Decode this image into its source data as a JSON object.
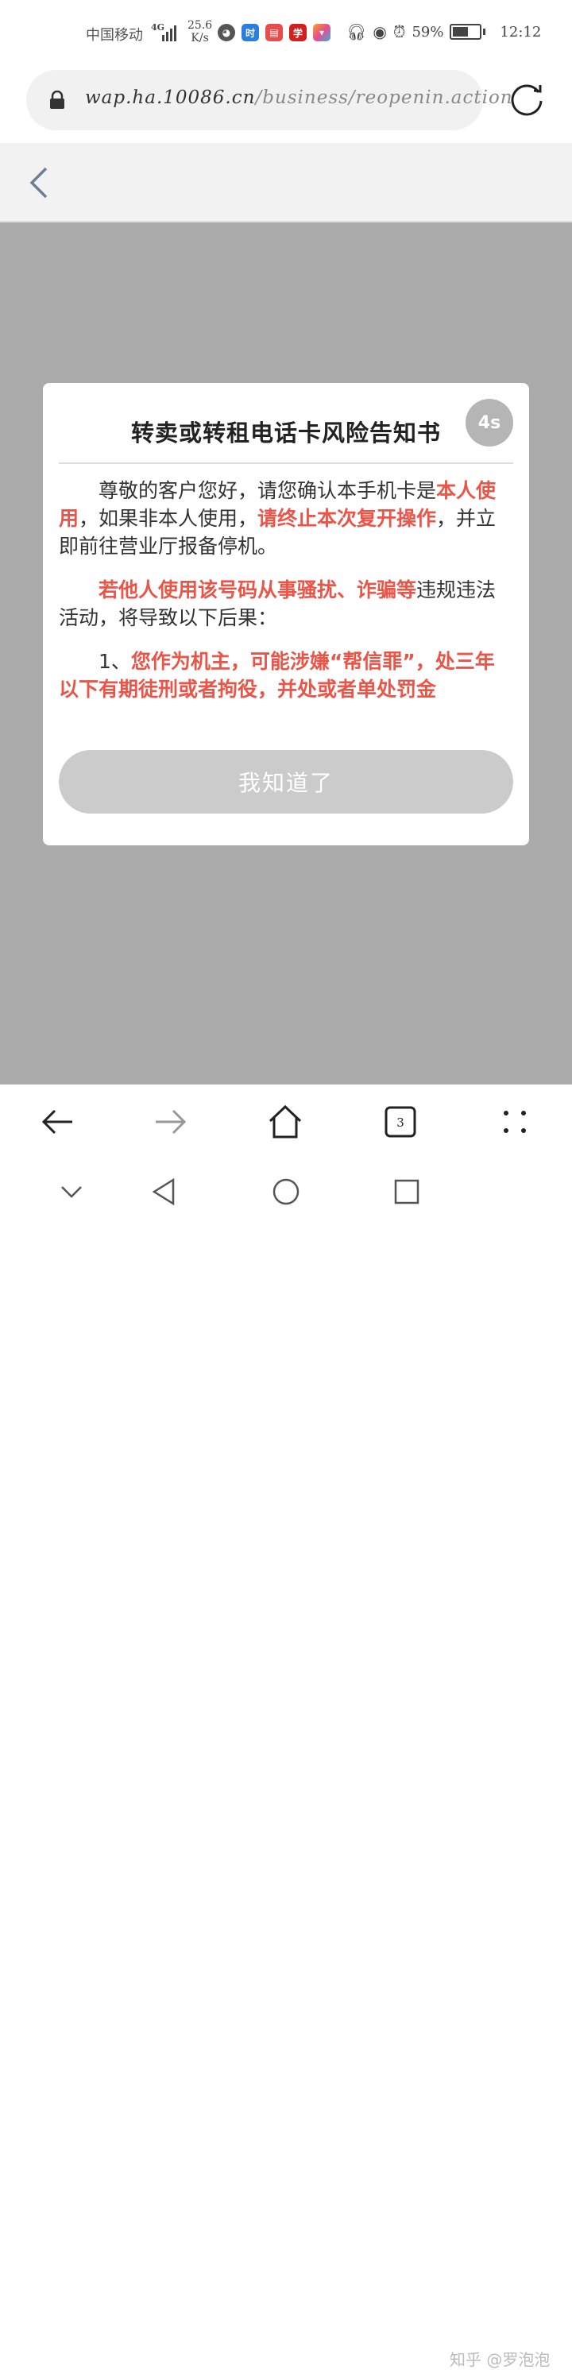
{
  "status_bar": {
    "carrier": "中国移动",
    "network": "4G",
    "speed_value": "25.6",
    "speed_unit": "K/s",
    "battery": "59%",
    "time": "12:12",
    "app_icons": [
      "browser-icon",
      "time-app-icon",
      "reader-icon",
      "study-app-icon",
      "photo-app-icon"
    ]
  },
  "url_bar": {
    "domain": "wap.ha.10086.cn",
    "path": "/business/reopenin.action"
  },
  "modal": {
    "title": "转卖或转租电话卡风险告知书",
    "countdown": "4s",
    "p1": {
      "a": "尊敬的客户您好，请您确认本手机卡是",
      "b": "本人使用",
      "c": "，如果非本人使用，",
      "d": "请终止本次复开操作",
      "e": "，并立即前往营业厅报备停机。"
    },
    "p2": {
      "a": "若他人使用该号码从事骚扰、诈骗等",
      "b": "违规违法活动，将导致以下后果："
    },
    "p3": {
      "a": "1、",
      "b": "您作为机主，可能涉嫌“帮信罪”，处三年以下有期徒刑或者拘役，并处或者单处罚金"
    },
    "button_label": "我知道了"
  },
  "watermark": "知乎 @罗泡泡",
  "colors": {
    "overlay": "#ababab",
    "highlight_red": "#e95548",
    "button_disabled": "#cbcbcb"
  }
}
